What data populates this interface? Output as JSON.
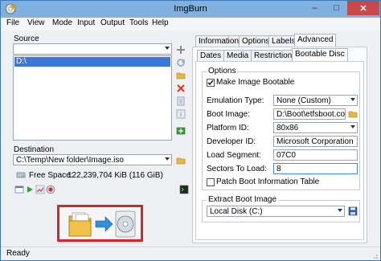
{
  "window": {
    "title": "ImgBurn",
    "minimize": "–",
    "maximize": "□",
    "close": "✕"
  },
  "menu": [
    "File",
    "View",
    "Mode",
    "Input",
    "Output",
    "Tools",
    "Help"
  ],
  "source": {
    "label": "Source",
    "selected": "",
    "list_item": "D:\\"
  },
  "destination": {
    "label": "Destination",
    "path": "C:\\Temp\\New folder\\Image.iso",
    "free_space_label": "Free Space:",
    "free_space_value": "122,239,704 KiB  (116 GiB)"
  },
  "tabs_top": [
    "Information",
    "Options",
    "Labels",
    "Advanced"
  ],
  "tabs_sub": [
    "Dates",
    "Media",
    "Restrictions",
    "Bootable Disc"
  ],
  "bootable": {
    "options_label": "Options",
    "make_bootable_label": "Make Image Bootable",
    "make_bootable_checked": true,
    "emulation_type_label": "Emulation Type:",
    "emulation_type_value": "None (Custom)",
    "boot_image_label": "Boot Image:",
    "boot_image_value": "D:\\Boot\\etfsboot.com",
    "platform_id_label": "Platform ID:",
    "platform_id_value": "80x86",
    "developer_id_label": "Developer ID:",
    "developer_id_value": "Microsoft Corporation",
    "load_segment_label": "Load Segment:",
    "load_segment_value": "07C0",
    "sectors_label": "Sectors To Load:",
    "sectors_value": "8",
    "patch_label": "Patch Boot Information Table",
    "patch_checked": false,
    "extract_label": "Extract Boot Image",
    "extract_value": "Local Disk (C:)"
  },
  "status": "Ready",
  "colors": {
    "accent_red": "#d4262b",
    "titlebar": "#7fb0de",
    "close": "#c7494a"
  }
}
